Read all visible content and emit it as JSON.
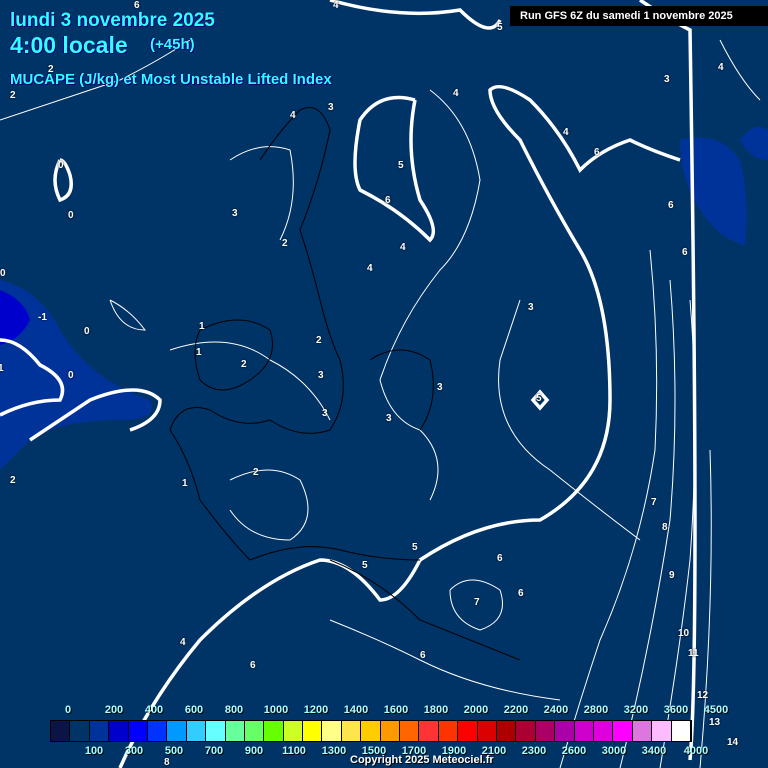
{
  "header": {
    "date": "lundi 3 novembre 2025",
    "time": "4:00 locale",
    "lead": "(+45h)",
    "parameter": "MUCAPE (J/kg) et Most Unstable Lifted Index",
    "run": "Run GFS 6Z du samedi 1 novembre 2025"
  },
  "contour_labels": [
    "6",
    "4",
    "5",
    "2",
    "2",
    "3",
    "4",
    "4",
    "3",
    "4",
    "5",
    "6",
    "4",
    "6",
    "0",
    "0",
    "3",
    "2",
    "4",
    "4",
    "3",
    "6",
    "6",
    "0",
    "-1",
    "0",
    "1",
    "1",
    "2",
    "2",
    "3",
    "3",
    "0",
    "1",
    "2",
    "5",
    "3",
    "3",
    "2",
    "1",
    "5",
    "5",
    "6",
    "7",
    "6",
    "7",
    "8",
    "9",
    "4",
    "6",
    "10",
    "11",
    "6",
    "12",
    "13",
    "14",
    "8"
  ],
  "legend": {
    "colors": [
      "#0a1446",
      "#003366",
      "#003399",
      "#0000cc",
      "#0000ff",
      "#0033ff",
      "#0099ff",
      "#33ccff",
      "#66ffff",
      "#66ff99",
      "#66ff66",
      "#66ff00",
      "#ccff22",
      "#ffff00",
      "#ffff88",
      "#ffe44d",
      "#ffcc00",
      "#ff9900",
      "#ff6600",
      "#ff3333",
      "#ff3300",
      "#ff0000",
      "#dd0000",
      "#aa0000",
      "#aa0033",
      "#aa0066",
      "#aa00aa",
      "#cc00cc",
      "#dd00dd",
      "#ff00ff",
      "#dd77dd",
      "#ffbbff",
      "#ffffff"
    ],
    "top_ticks": [
      "0",
      "200",
      "400",
      "600",
      "800",
      "1000",
      "1200",
      "1400",
      "1600",
      "1800",
      "2000",
      "2200",
      "2400",
      "2800",
      "3200",
      "3600",
      "4500"
    ],
    "bottom_ticks": [
      "100",
      "300",
      "500",
      "700",
      "900",
      "1100",
      "1300",
      "1500",
      "1700",
      "1900",
      "2100",
      "2300",
      "2600",
      "3000",
      "3400",
      "4000"
    ]
  },
  "copyright": "Copyright 2025 Meteociel.fr"
}
